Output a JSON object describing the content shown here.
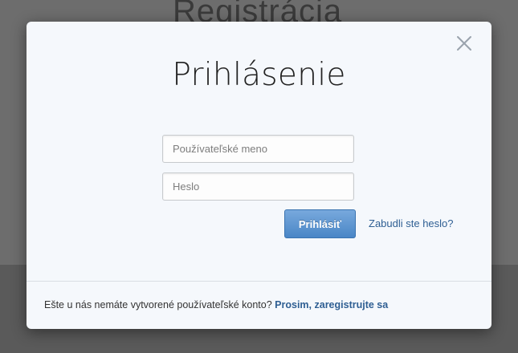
{
  "background": {
    "title": "Registrácia"
  },
  "modal": {
    "title": "Prihlásenie",
    "close_icon": "close-icon",
    "username_placeholder": "Používateľské meno",
    "password_placeholder": "Heslo",
    "login_label": "Prihlásiť",
    "forgot_link": "Zabudli ste heslo?",
    "footer_text": "Ešte u nás nemáte vytvorené používateľské konto?",
    "register_link": "Prosim, zaregistrujte sa"
  },
  "colors": {
    "accent": "#4a86c6",
    "link": "#2f5f93",
    "modal_bg": "#f5f8fc",
    "overlay": "#6d6d6d"
  }
}
